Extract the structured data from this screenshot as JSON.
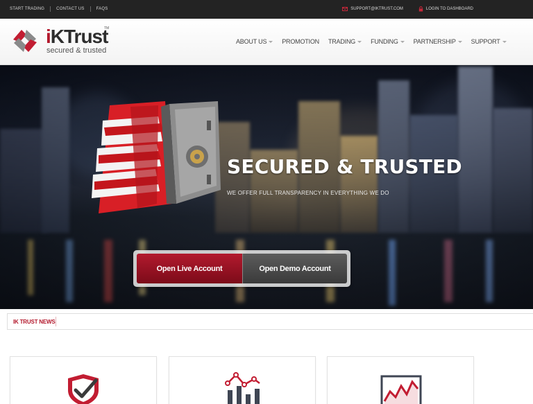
{
  "topbar": {
    "links": [
      "START TRADING",
      "CONTACT US",
      "FAQS"
    ],
    "email": "SUPPORT@IKTRUST.COM",
    "login": "LOGIN TO DASHBOARD"
  },
  "logo": {
    "brand_i": "i",
    "brand_rest": "KTrust",
    "tm": "TM",
    "tagline": "secured & trusted"
  },
  "nav": [
    {
      "label": "ABOUT US",
      "caret": true
    },
    {
      "label": "PROMOTION",
      "caret": false
    },
    {
      "label": "TRADING",
      "caret": true
    },
    {
      "label": "FUNDING",
      "caret": true
    },
    {
      "label": "PARTNERSHIP",
      "caret": true
    },
    {
      "label": "SUPPORT",
      "caret": true
    }
  ],
  "hero": {
    "headline": "SECURED & TRUSTED",
    "subline": "WE OFFER FULL TRANSPARENCY IN EVERYTHING WE DO",
    "live_button": "Open Live Account",
    "demo_button": "Open Demo Account"
  },
  "news": {
    "label": "IK TRUST NEWS"
  },
  "cards": [
    {
      "icon": "shield-check-icon"
    },
    {
      "icon": "analytics-chart-icon"
    },
    {
      "icon": "line-chart-icon"
    }
  ],
  "colors": {
    "brand_red": "#b3182c",
    "topbar": "#232323",
    "demo_gray": "#4a4a4a"
  }
}
